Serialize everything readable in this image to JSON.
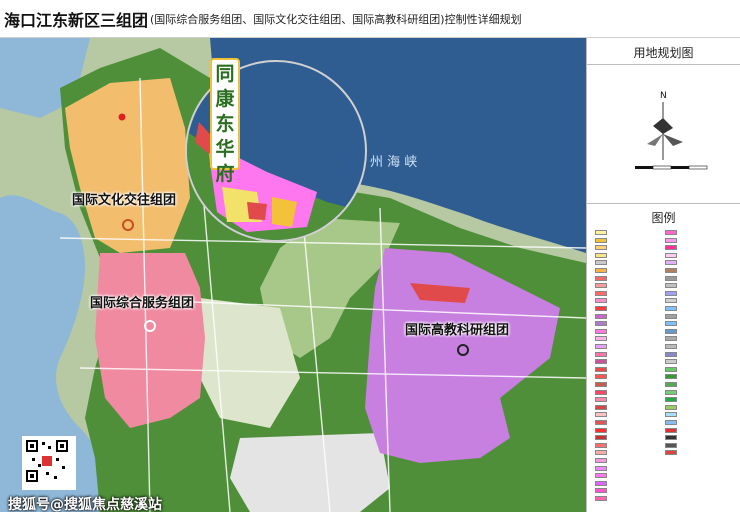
{
  "header": {
    "title": "海口江东新区三组团",
    "subtitle": "(国际综合服务组团、国际文化交往组团、国际高教科研组团)控制性详细规划"
  },
  "map": {
    "callout_label": "同康东华府",
    "zones": [
      {
        "label": "国际文化交往组团",
        "color": "#f2be6e"
      },
      {
        "label": "国际综合服务组团",
        "color": "#f08aa0"
      },
      {
        "label": "国际高教科研组团",
        "color": "#c77fe0"
      }
    ],
    "sea_label": "州  海  峡",
    "watermark": "搜狐号@搜狐焦点慈溪站",
    "colors": {
      "sea": "#2f5d92",
      "river": "#8fb8d8",
      "green": "#4f8f3a",
      "land": "#c9d7b5"
    }
  },
  "sidebar": {
    "title": "用地规划图",
    "legend_title": "图例",
    "north_label": "N",
    "legend_swatches": [
      "#fff3a0",
      "#f3c23a",
      "#ffd27a",
      "#f7e38a",
      "#c9c9c9",
      "#ffb347",
      "#f06a6a",
      "#ff9a9a",
      "#ff6a6a",
      "#ff8fc8",
      "#ff3a3a",
      "#cc66cc",
      "#b07acc",
      "#ff7adf",
      "#ffb3e6",
      "#e7a0ff",
      "#ff77aa",
      "#cc5599",
      "#e94a4a",
      "#ff5555",
      "#c85b4a",
      "#ff4466",
      "#ff88aa",
      "#d94444",
      "#ffc1c1",
      "#e05555",
      "#ff2d2d",
      "#c83232",
      "#ff6f6f",
      "#ffaaaa",
      "#ff99dd",
      "#ee88ff",
      "#ff77ee",
      "#dd66ff",
      "#ff55cc",
      "#ff66aa"
    ],
    "legend_swatches_right": [
      "#ff66cc",
      "#ff99ee",
      "#ff3399",
      "#ffccee",
      "#e0b0ff",
      "#b08060",
      "#9a9a9a",
      "#c0c0c0",
      "#a0a0ff",
      "#d0d0d0",
      "#80c0ff",
      "#a0a0a0",
      "#7fbfff",
      "#6699cc",
      "#aaaaaa",
      "#bbbbbb",
      "#8888cc",
      "#cccccc",
      "#66cc66",
      "#339933",
      "#55aa55",
      "#77cc77",
      "#22aa44",
      "#99cc66",
      "#aaddff",
      "#88bbee",
      "#dd3333",
      "#333333",
      "#555555",
      "#dd4444"
    ]
  }
}
